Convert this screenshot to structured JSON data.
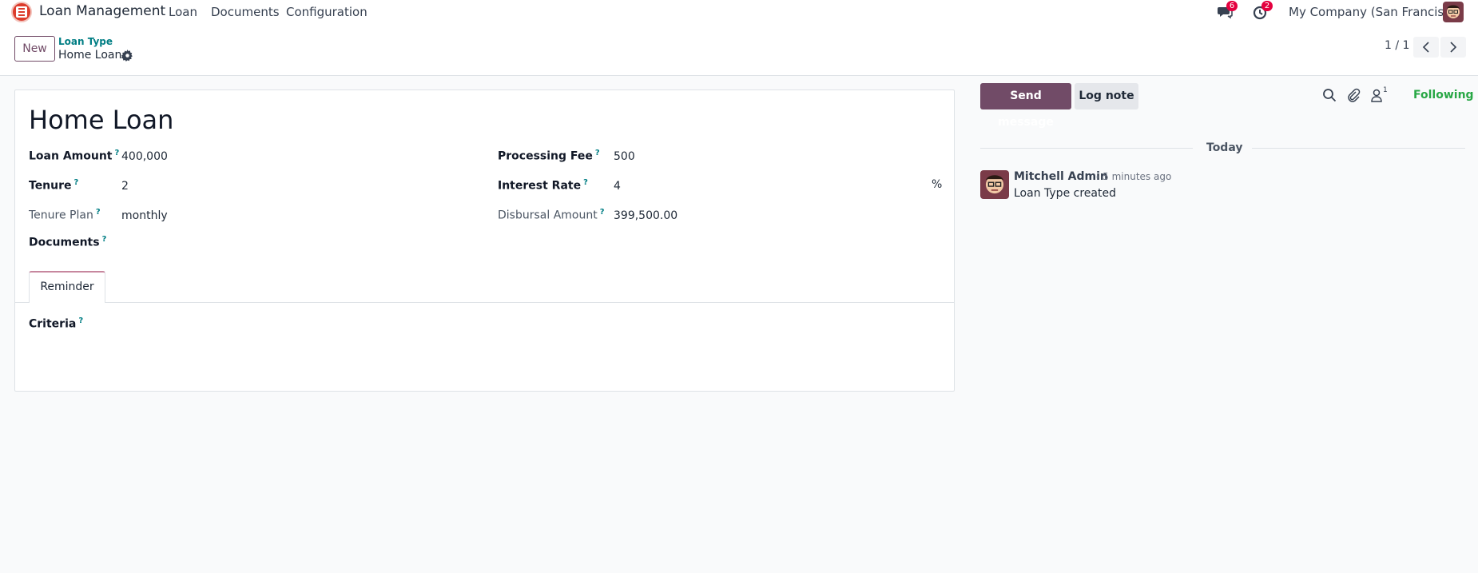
{
  "navbar": {
    "app_name": "Loan Management",
    "menu": [
      "Loan",
      "Documents",
      "Configuration"
    ],
    "messages_badge": "6",
    "activities_badge": "2",
    "company": "My Company (San Francisco)"
  },
  "control": {
    "new_label": "New",
    "breadcrumb_parent": "Loan Type",
    "breadcrumb_current": "Home Loan",
    "pager": "1 / 1"
  },
  "form": {
    "title": "Home Loan",
    "left": [
      {
        "label": "Loan Amount",
        "value": "400,000"
      },
      {
        "label": "Tenure",
        "value": "2"
      },
      {
        "label": "Tenure Plan",
        "value": "monthly"
      },
      {
        "label": "Documents",
        "value": ""
      }
    ],
    "right": [
      {
        "label": "Processing Fee",
        "value": "500"
      },
      {
        "label": "Interest Rate",
        "value": "4",
        "suffix": "%"
      },
      {
        "label": "Disbursal Amount",
        "value": "399,500.00"
      }
    ],
    "help_mark": "?",
    "tab_label": "Reminder",
    "criteria_label": "Criteria"
  },
  "chatter": {
    "send_message": "Send message",
    "log_note": "Log note",
    "followers_count": "1",
    "following": "Following",
    "day": "Today",
    "message": {
      "author": "Mitchell Admin",
      "time": "- 5 minutes ago",
      "body": "Loan Type created"
    }
  },
  "colors": {
    "primary": "#714b67",
    "link": "#017e84",
    "success": "#28a745",
    "badge": "#e4013f"
  }
}
